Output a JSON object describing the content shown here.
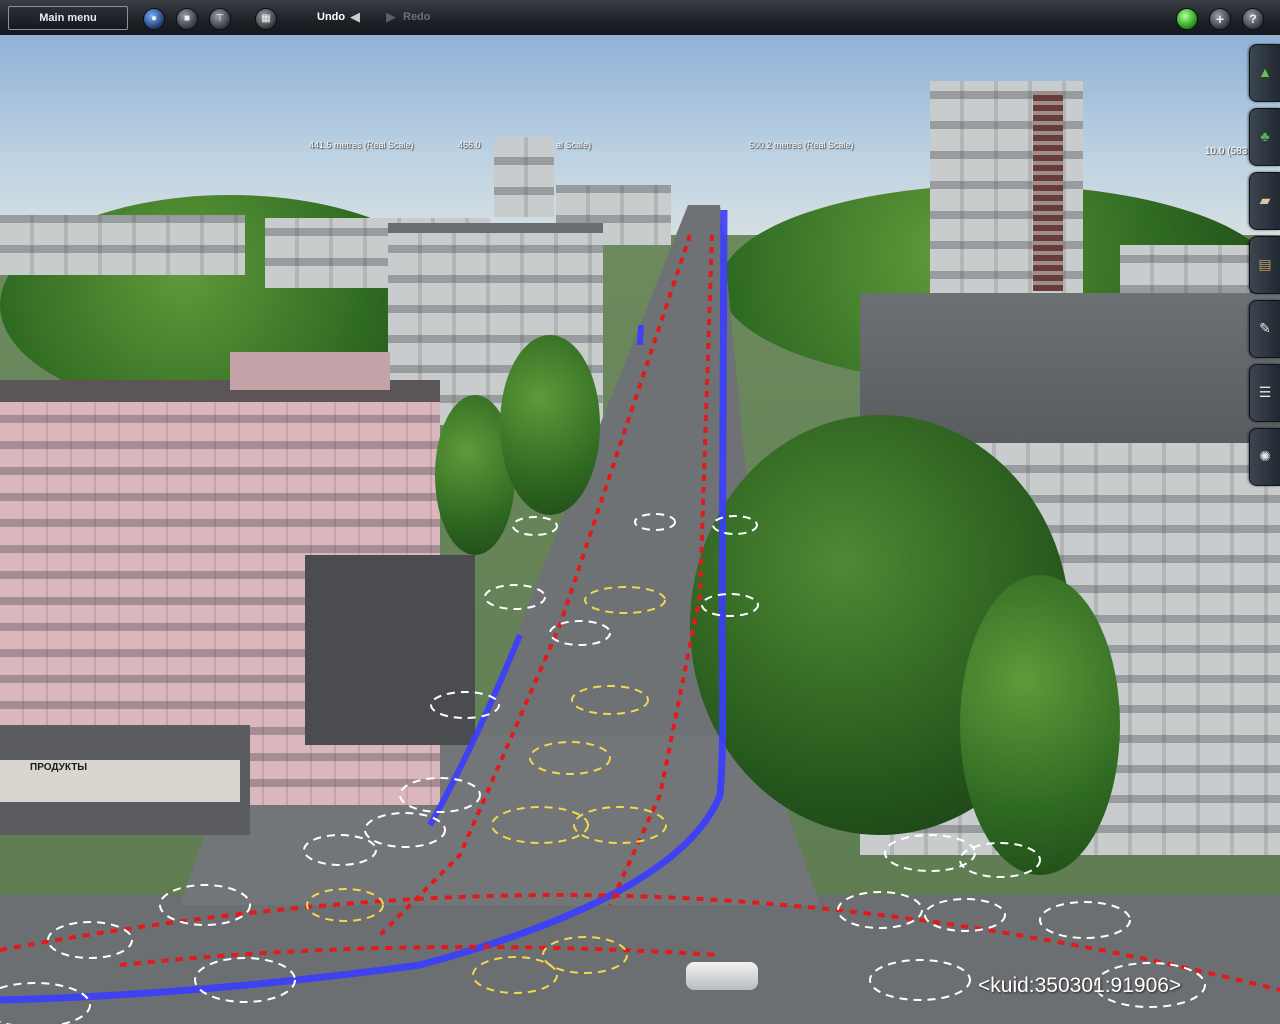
{
  "toolbar": {
    "main_menu_label": "Main menu",
    "undo_label": "Undo",
    "redo_label": "Redo",
    "undo_enabled": true,
    "redo_enabled": false,
    "tool_icons": [
      "globe-icon",
      "stop-icon",
      "tool-icon",
      "grid-icon"
    ],
    "right_icons": [
      "status-light-icon",
      "add-icon",
      "help-icon"
    ],
    "status_light_color": "#3fce2f"
  },
  "viewport": {
    "distance_labels": [
      "441.5 metres  (Real Scale)",
      "466.0",
      "al Scale)",
      "500.2 metres  (Real Scale)",
      "10.0 (583"
    ],
    "shop_sign": "ПРОДУКТЫ",
    "kuid_label": "<kuid:350301:91906>"
  },
  "side_panel": {
    "tabs": [
      "trackside-icon",
      "scenery-icon",
      "buildings-icon",
      "tracks-icon",
      "tools-icon",
      "layers-icon",
      "settings-icon"
    ]
  },
  "colors": {
    "track_blue": "#3a3dff",
    "spline_red": "#e11a1a",
    "marker_white": "#ffffff",
    "marker_yellow": "#f2d84a"
  }
}
